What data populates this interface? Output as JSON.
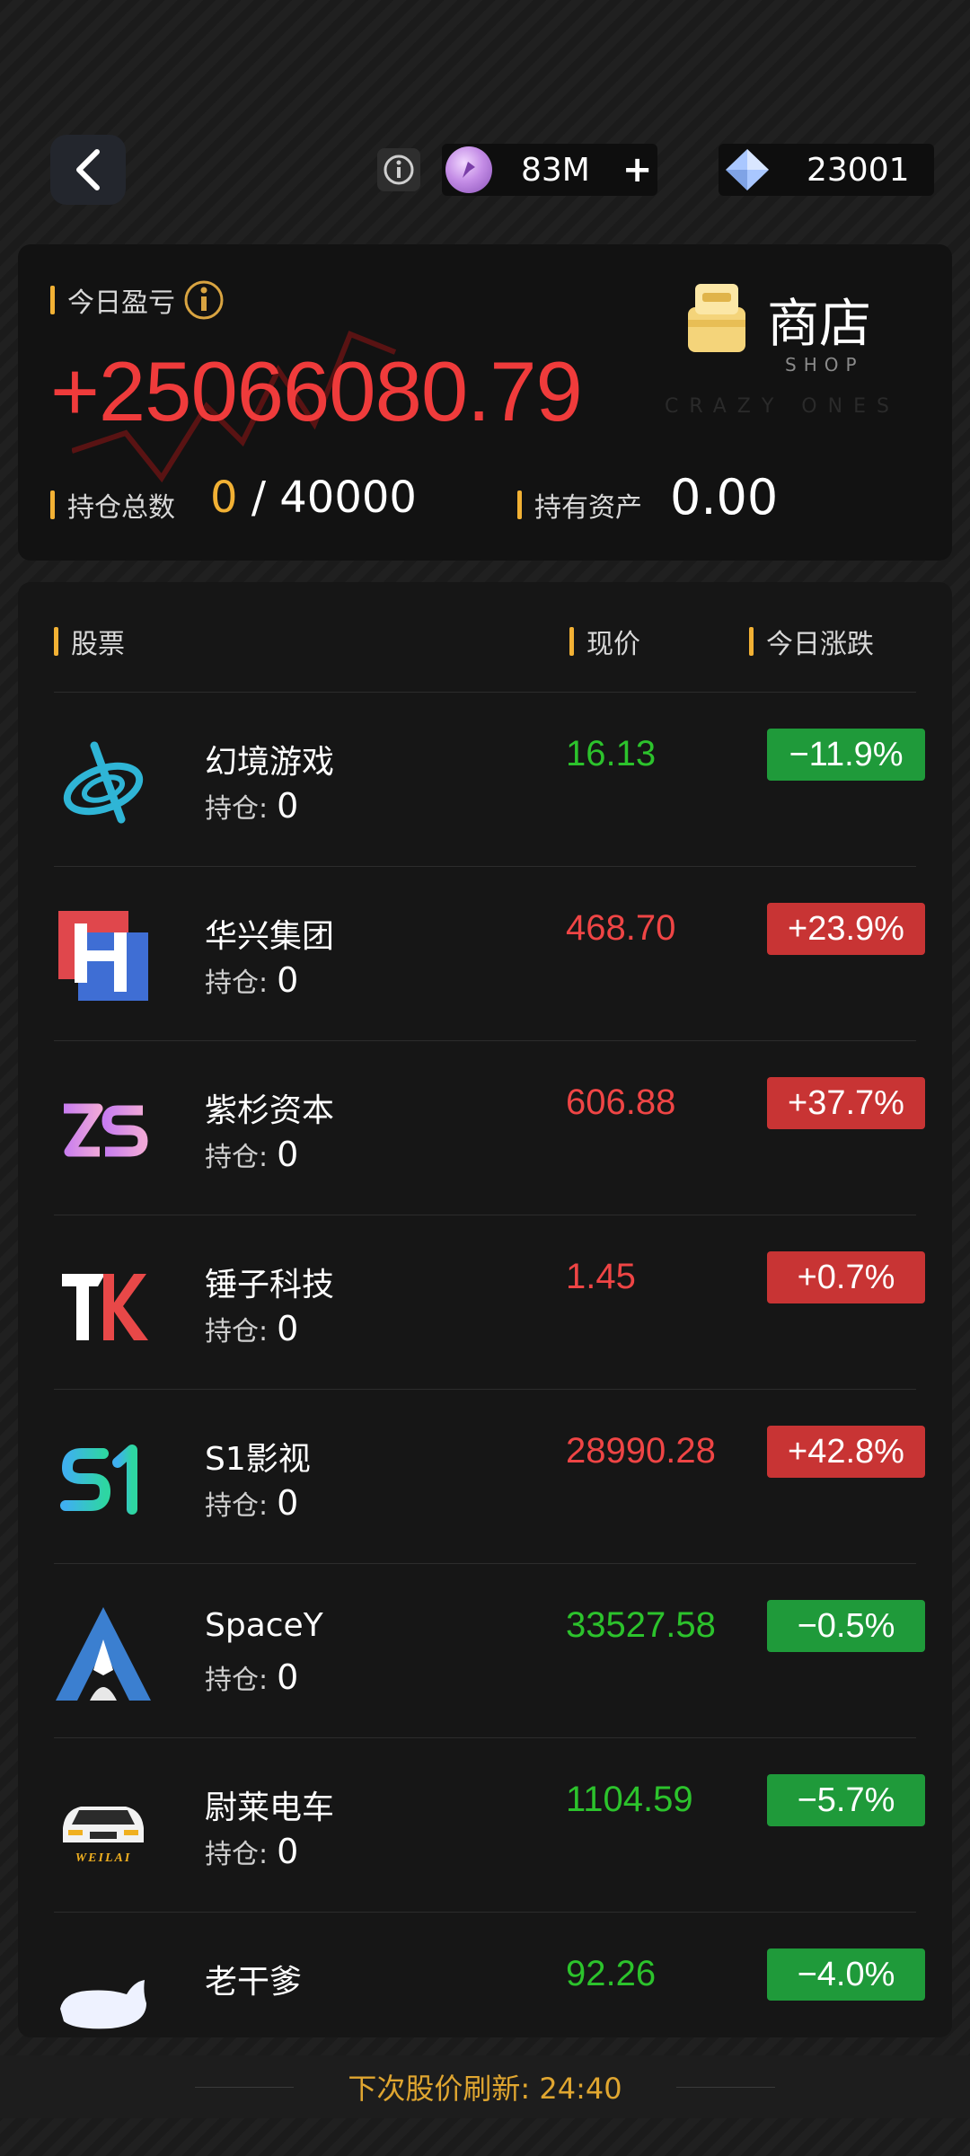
{
  "topbar": {
    "coins": "83M",
    "gems": "23001",
    "plus": "+"
  },
  "summary": {
    "pnl_label": "今日盈亏",
    "pnl_value": "+25066080.79",
    "shop_label": "商店",
    "shop_sub": "SHOP",
    "watermark": "CRAZY ONES",
    "holdings_label": "持仓总数",
    "holdings_current": "0",
    "holdings_max": "/ 40000",
    "assets_label": "持有资产",
    "assets_value": "0.00"
  },
  "list": {
    "headers": {
      "stock": "股票",
      "price": "现价",
      "change": "今日涨跌"
    },
    "hold_label": "持仓:",
    "stocks": [
      {
        "name": "幻境游戏",
        "hold": "0",
        "price": "16.13",
        "change": "−11.9%",
        "trend": "down",
        "logo": "fantasy-game-logo"
      },
      {
        "name": "华兴集团",
        "hold": "0",
        "price": "468.70",
        "change": "+23.9%",
        "trend": "up",
        "logo": "huaxing-logo"
      },
      {
        "name": "紫杉资本",
        "hold": "0",
        "price": "606.88",
        "change": "+37.7%",
        "trend": "up",
        "logo": "zs-logo"
      },
      {
        "name": "锤子科技",
        "hold": "0",
        "price": "1.45",
        "change": "+0.7%",
        "trend": "up",
        "logo": "hammer-tk-logo"
      },
      {
        "name": "S1影视",
        "hold": "0",
        "price": "28990.28",
        "change": "+42.8%",
        "trend": "up",
        "logo": "s1-logo"
      },
      {
        "name": "SpaceY",
        "hold": "0",
        "price": "33527.58",
        "change": "−0.5%",
        "trend": "down",
        "logo": "rocket-logo"
      },
      {
        "name": "尉莱电车",
        "hold": "0",
        "price": "1104.59",
        "change": "−5.7%",
        "trend": "down",
        "logo": "weilai-car-logo",
        "logo_text": "WEILAI"
      },
      {
        "name": "老干爹",
        "hold": "",
        "price": "92.26",
        "change": "−4.0%",
        "trend": "down",
        "logo": "laoganda-logo"
      }
    ]
  },
  "footer": {
    "refresh": "下次股价刷新: 24:40"
  }
}
